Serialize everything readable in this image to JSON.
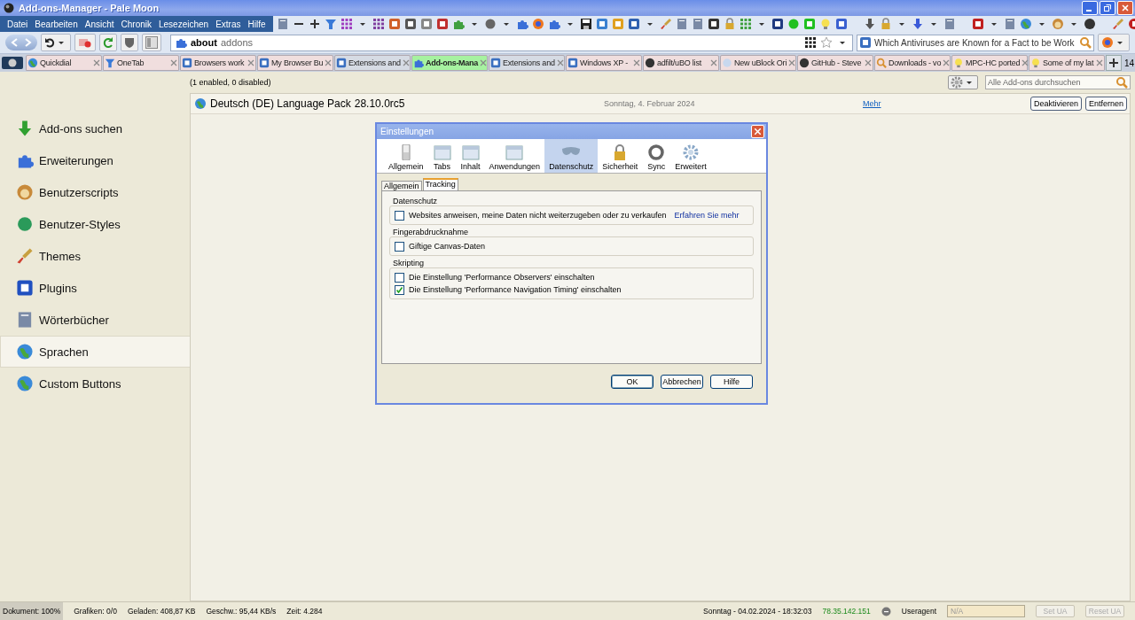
{
  "window": {
    "title": "Add-ons-Manager - Pale Moon"
  },
  "menu": [
    "Datei",
    "Bearbeiten",
    "Ansicht",
    "Chronik",
    "Lesezeichen",
    "Extras",
    "Hilfe"
  ],
  "address_bar": {
    "host": "about",
    "path": "addons"
  },
  "search_bar": {
    "value": "Which Antiviruses are Known for a Fact to be Work"
  },
  "tabs": [
    {
      "label": "Quickdial",
      "selected": false,
      "color": "#f0dede"
    },
    {
      "label": "OneTab",
      "selected": false,
      "color": "#f0dede"
    },
    {
      "label": "Browsers work",
      "selected": false,
      "color": "#f0dede"
    },
    {
      "label": "My Browser Bu",
      "selected": false,
      "color": "#f0dede"
    },
    {
      "label": "Extensions and",
      "selected": false,
      "color": "#d6dbe4"
    },
    {
      "label": "Add-ons-Mana",
      "selected": true,
      "color": "#a6f2a0"
    },
    {
      "label": "Extensions and",
      "selected": false,
      "color": "#d6dbe4"
    },
    {
      "label": "Windows XP -",
      "selected": false,
      "color": "#f0dede"
    },
    {
      "label": "adfilt/uBO list",
      "selected": false,
      "color": "#f0dede"
    },
    {
      "label": "New uBlock Ori",
      "selected": false,
      "color": "#f0dede"
    },
    {
      "label": "GitHub - Steve",
      "selected": false,
      "color": "#f0dede"
    },
    {
      "label": "Downloads - vo",
      "selected": false,
      "color": "#f0dede"
    },
    {
      "label": "MPC-HC ported",
      "selected": false,
      "color": "#f0dede"
    },
    {
      "label": "Some of my lat",
      "selected": false,
      "color": "#f0dede"
    }
  ],
  "tab_count": "14",
  "sidebar": {
    "items": [
      {
        "label": "Add-ons suchen",
        "selected": false
      },
      {
        "label": "Erweiterungen",
        "selected": false
      },
      {
        "label": "Benutzerscripts",
        "selected": false
      },
      {
        "label": "Benutzer-Styles",
        "selected": false
      },
      {
        "label": "Themes",
        "selected": false
      },
      {
        "label": "Plugins",
        "selected": false
      },
      {
        "label": "Wörterbücher",
        "selected": false
      },
      {
        "label": "Sprachen",
        "selected": true
      },
      {
        "label": "Custom Buttons",
        "selected": false
      }
    ]
  },
  "addons": {
    "summary": "(1 enabled, 0 disabled)",
    "search_placeholder": "Alle Add-ons durchsuchen",
    "items": [
      {
        "name": "Deutsch (DE) Language Pack",
        "version": "28.10.0rc5",
        "date": "Sonntag, 4. Februar 2024",
        "more_link": "Mehr",
        "buttons": [
          "Deaktivieren",
          "Entfernen"
        ]
      }
    ]
  },
  "dialog": {
    "title": "Einstellungen",
    "panes": [
      {
        "label": "Allgemein",
        "selected": false
      },
      {
        "label": "Tabs",
        "selected": false
      },
      {
        "label": "Inhalt",
        "selected": false
      },
      {
        "label": "Anwendungen",
        "selected": false
      },
      {
        "label": "Datenschutz",
        "selected": true
      },
      {
        "label": "Sicherheit",
        "selected": false
      },
      {
        "label": "Sync",
        "selected": false
      },
      {
        "label": "Erweitert",
        "selected": false
      }
    ],
    "subtabs": [
      {
        "label": "Allgemein",
        "selected": false
      },
      {
        "label": "Tracking",
        "selected": true
      }
    ],
    "groups": [
      {
        "title": "Datenschutz",
        "options": [
          {
            "label": "Websites anweisen, meine Daten nicht weiterzugeben oder zu verkaufen",
            "checked": false,
            "link": "Erfahren Sie mehr"
          }
        ]
      },
      {
        "title": "Fingerabdrucknahme",
        "options": [
          {
            "label": "Giftige Canvas-Daten",
            "checked": false
          }
        ]
      },
      {
        "title": "Skripting",
        "options": [
          {
            "label": "Die Einstellung 'Performance Observers' einschalten",
            "checked": false
          },
          {
            "label": "Die Einstellung 'Performance Navigation Timing' einschalten",
            "checked": true
          }
        ]
      }
    ],
    "buttons": [
      "OK",
      "Abbrechen",
      "Hilfe"
    ]
  },
  "status_bar": {
    "document": "Dokument: 100%",
    "images": "Grafiken: 0/0",
    "loaded": "Geladen: 408,87 KB",
    "speed": "Geschw.: 95,44 KB/s",
    "time": "Zeit: 4.284",
    "datetime": "Sonntag - 04.02.2024 - 18:32:03",
    "ip": "78.35.142.151",
    "useragent_label": "Useragent",
    "useragent_placeholder": "N/A",
    "buttons": [
      {
        "label": "Set UA",
        "disabled": true
      },
      {
        "label": "Reset UA",
        "disabled": true
      }
    ]
  }
}
